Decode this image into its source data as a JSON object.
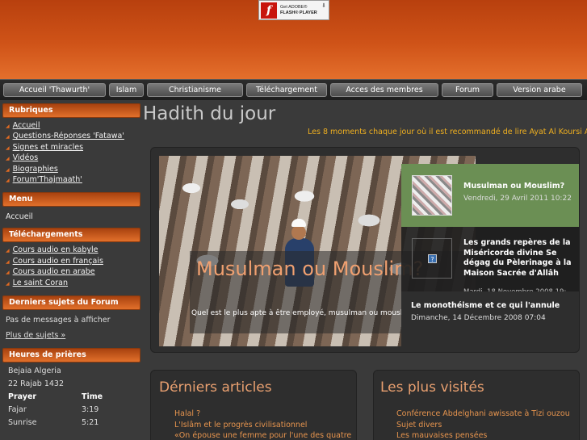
{
  "flash_badge": {
    "line1": "Get ADOBE®",
    "line2": "FLASH® PLAYER"
  },
  "nav": {
    "items": [
      {
        "label": "Accueil 'Thawurth'"
      },
      {
        "label": "Islam"
      },
      {
        "label": "Christianisme"
      },
      {
        "label": "Téléchargement"
      },
      {
        "label": "Acces des membres"
      },
      {
        "label": "Forum"
      },
      {
        "label": "Version arabe"
      }
    ]
  },
  "sidebar": {
    "rubriques": {
      "title": "Rubriques",
      "links": [
        "Accueil",
        "Questions-Réponses 'Fatawa'",
        "Signes et miracles",
        "Vidéos",
        "Biographies",
        "Forum'Thajmaath'"
      ]
    },
    "menu": {
      "title": "Menu",
      "items": [
        "Accueil"
      ]
    },
    "telechargements": {
      "title": "Téléchargements",
      "links": [
        "Cours audio en kabyle",
        "Cours audio en français",
        "Cours audio en arabe",
        "Le saint Coran"
      ]
    },
    "forum": {
      "title": "Derniers sujets du Forum",
      "empty_text": "Pas de messages à afficher",
      "more_link": "Plus de sujets »"
    },
    "prayer": {
      "title": "Heures de prières",
      "city": "Bejaia Algeria",
      "hijri_date": "22 Rajab 1432",
      "col_prayer": "Prayer",
      "col_time": "Time",
      "rows": [
        {
          "name": "Fajar",
          "time": "3:19"
        },
        {
          "name": "Sunrise",
          "time": "5:21"
        }
      ]
    }
  },
  "main": {
    "title": "Hadith du jour",
    "ticker": "Les 8 moments chaque jour où il est recommandé de lire Ayat Al Koursi Au"
  },
  "slider": {
    "current_title": "Musulman ou Mouslim?",
    "current_description": "Quel est le plus apte à être employé, musulman ou mouslim?",
    "items": [
      {
        "title": "Musulman ou Mouslim?",
        "date": "Vendredi, 29 Avril 2011 10:22"
      },
      {
        "title": "Les grands repères de la Miséricorde divine Se dégag du Pèlerinage à la Maison Sacrée d'Allâh",
        "date": "Mardi, 18 Novembre 2008 19:"
      },
      {
        "title": "Le monothéisme et ce qui l'annule",
        "date": "Dimanche, 14 Décembre 2008 07:04"
      }
    ],
    "placeholder_glyph": "?"
  },
  "articles": {
    "title": "Dérniers articles",
    "links": [
      "Halal ?",
      "L'Islâm et le progrès civilisationnel",
      "«On épouse une femme pour l'une des quatre"
    ]
  },
  "visited": {
    "title": "Les plus visités",
    "links": [
      "Conférence Abdelghani awissate à Tizi ouzou",
      "Sujet divers",
      "Les mauvaises pensées"
    ]
  },
  "colors": {
    "accent": "#e06a22",
    "link_orange": "#e6944e",
    "ticker": "#f0b020",
    "slide_active": "#6b8f54"
  }
}
